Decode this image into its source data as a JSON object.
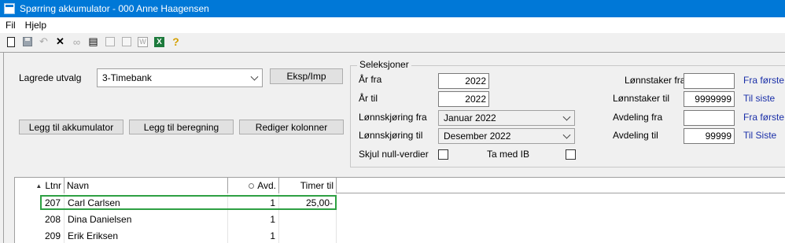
{
  "window": {
    "title": "Spørring akkumulator - 000 Anne Haagensen"
  },
  "menu": [
    "Fil",
    "Hjelp"
  ],
  "toolbar": {
    "icons": [
      "new-document-icon",
      "save-icon",
      "undo-icon",
      "delete-icon",
      "binoculars-icon",
      "print-icon",
      "preview-icon",
      "copy-icon",
      "word-icon",
      "excel-icon",
      "help-key-icon"
    ],
    "word_glyph": "W",
    "excel_glyph": "X",
    "help_glyph": "?"
  },
  "left": {
    "saved_selection_label": "Lagrede utvalg",
    "saved_selection_value": "3-Timebank",
    "export_import_button": "Eksp/Imp",
    "add_accumulator_button": "Legg til akkumulator",
    "add_calculation_button": "Legg til beregning",
    "edit_columns_button": "Rediger kolonner"
  },
  "selection": {
    "title": "Seleksjoner",
    "year_from_label": "År fra",
    "year_from_value": "2022",
    "year_to_label": "År til",
    "year_to_value": "2022",
    "payroll_from_label": "Lønnskjøring fra",
    "payroll_from_value": "Januar 2022",
    "payroll_to_label": "Lønnskjøring til",
    "payroll_to_value": "Desember 2022",
    "hide_zero_label": "Skjul null-verdier",
    "hide_zero_checked": false,
    "include_ib_label": "Ta med IB",
    "include_ib_checked": false,
    "employee_from_label": "Lønnstaker fra",
    "employee_from_value": "",
    "employee_to_label": "Lønnstaker til",
    "employee_to_value": "9999999",
    "department_from_label": "Avdeling fra",
    "department_from_value": "",
    "department_to_label": "Avdeling til",
    "department_to_value": "99999",
    "first_link_1": "Fra første",
    "last_link_1": "Til siste",
    "first_link_2": "Fra første",
    "last_link_2": "Til Siste"
  },
  "grid": {
    "columns": [
      "Ltnr",
      "Navn",
      "Avd.",
      "Timer til"
    ],
    "rows": [
      {
        "ltnr": "207",
        "navn": "Carl Carlsen",
        "avd": "1",
        "timer": "25,00-"
      },
      {
        "ltnr": "208",
        "navn": "Dina Danielsen",
        "avd": "1",
        "timer": ""
      },
      {
        "ltnr": "209",
        "navn": "Erik Eriksen",
        "avd": "1",
        "timer": ""
      }
    ],
    "highlighted_row": 0,
    "highlight_color": "#2ea043"
  },
  "colors": {
    "titlebar": "#0078d7",
    "link": "#1a2fa8"
  }
}
